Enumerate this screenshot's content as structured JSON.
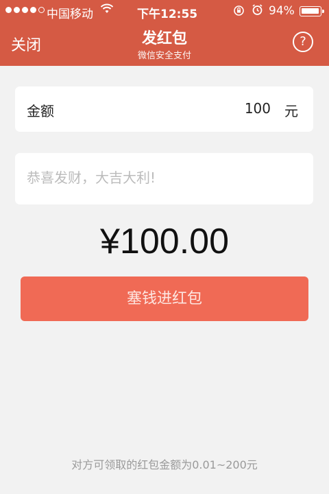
{
  "status_bar": {
    "carrier": "中国移动",
    "time": "下午12:55",
    "battery_pct": "94%",
    "battery_level": 0.94,
    "signal_bars": 4
  },
  "header": {
    "close_label": "关闭",
    "title": "发红包",
    "subtitle": "微信安全支付",
    "help_label": "?",
    "color": "#d55a44"
  },
  "amount_field": {
    "label": "金额",
    "value": "100",
    "unit": "元"
  },
  "message_field": {
    "placeholder": "恭喜发财，大吉大利!",
    "value": ""
  },
  "total_display": "¥100.00",
  "submit_button": {
    "label": "塞钱进红包",
    "color": "#f06a55"
  },
  "footer_note": "对方可领取的红包金额为0.01~200元"
}
